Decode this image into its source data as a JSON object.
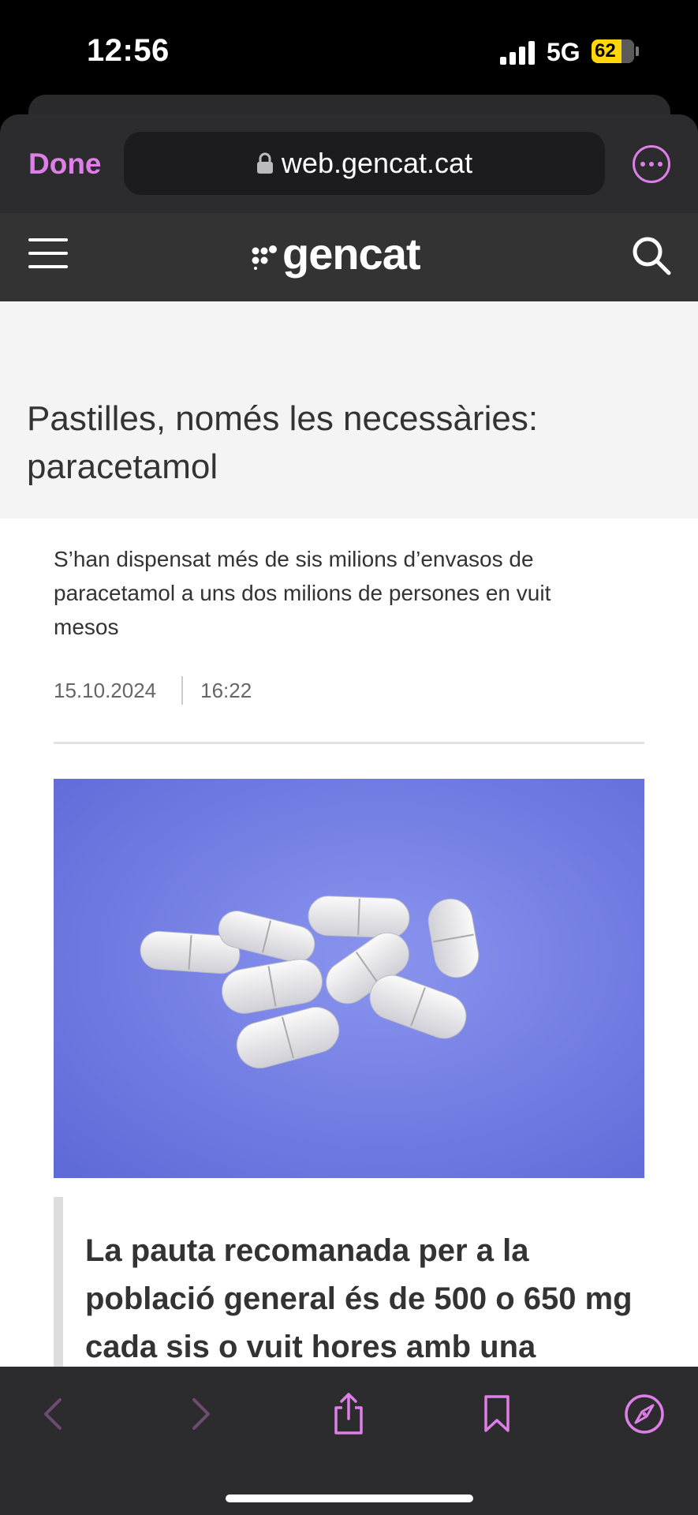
{
  "status_bar": {
    "time": "12:56",
    "network": "5G",
    "battery": "62"
  },
  "browser": {
    "done_label": "Done",
    "url": "web.gencat.cat",
    "accent_color": "#dd7fe6"
  },
  "site": {
    "logo_text": "gencat"
  },
  "article": {
    "title": "Pastilles, només les necessàries: paracetamol",
    "lede": "S’han dispensat més de sis milions d’envasos de paracetamol a uns dos milions de persones en vuit mesos",
    "date": "15.10.2024",
    "time": "16:22",
    "quote": "La pauta recomanada per a la població general és de 500 o 650 mg cada sis o vuit hores amb una"
  },
  "toolbar": {
    "icons": [
      "back-icon",
      "forward-icon",
      "share-icon",
      "bookmarks-icon",
      "compass-icon"
    ]
  }
}
